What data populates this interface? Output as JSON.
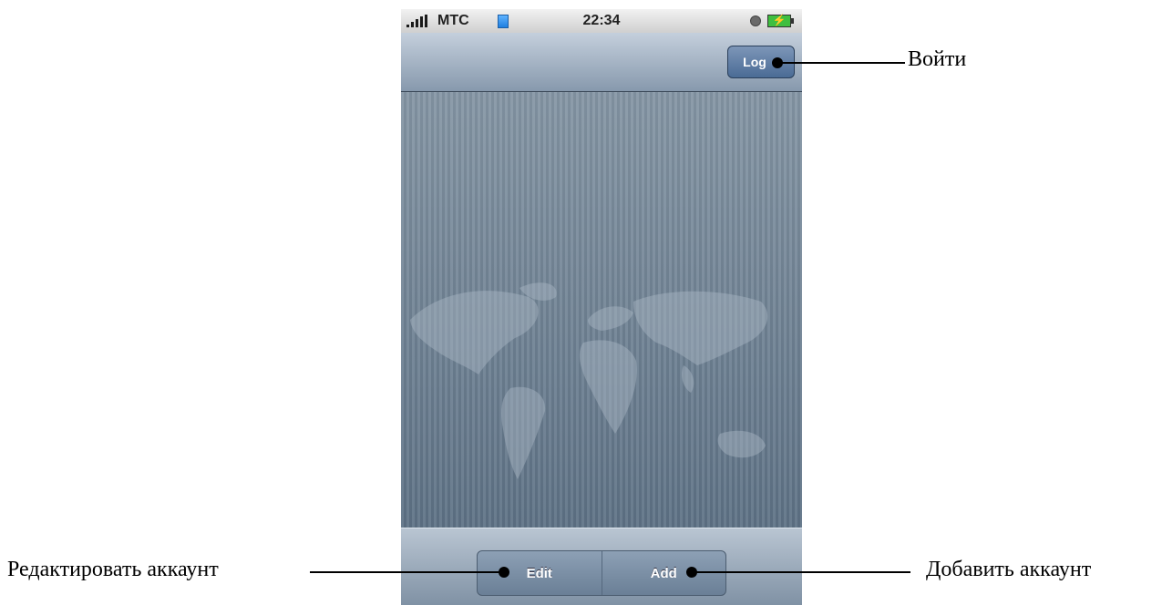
{
  "status_bar": {
    "carrier": "МТС",
    "time": "22:34"
  },
  "nav_bar": {
    "login_button": "Log"
  },
  "toolbar": {
    "edit_label": "Edit",
    "add_label": "Add"
  },
  "callouts": {
    "login": "Войти",
    "edit": "Редактировать аккаунт",
    "add": "Добавить аккаунт"
  },
  "icons": [
    "signal-strength-icon",
    "network-icon",
    "alarm-icon",
    "battery-charging-icon"
  ],
  "colors": {
    "nav_button": "#4a6b95",
    "content_bg": "#6b7f91"
  }
}
